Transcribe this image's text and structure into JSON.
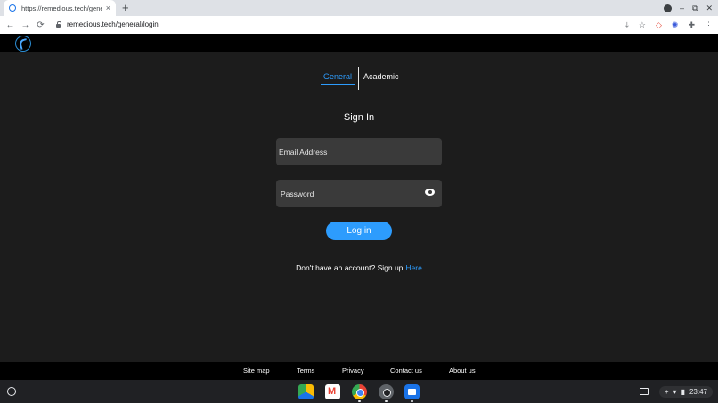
{
  "browser": {
    "tab_title": "https://remedious.tech/general/",
    "tab_close": "×",
    "new_tab": "+",
    "url": "remedious.tech/general/login",
    "nav": {
      "back": "←",
      "forward": "→",
      "reload": "⟳"
    },
    "window_controls": {
      "minimize": "–",
      "restore": "⧉",
      "close": "✕"
    }
  },
  "toolbar_icons": [
    "download-icon",
    "star-icon",
    "extension-red-icon",
    "extension-blue-icon",
    "puzzle-icon",
    "menu-icon"
  ],
  "toolbar_glyphs": {
    "download": "⤓",
    "star": "☆",
    "ext_red": "◇",
    "ext_blue": "✺",
    "puzzle": "✚",
    "menu": "⋮"
  },
  "login": {
    "tabs": {
      "general": "General",
      "academic": "Academic"
    },
    "title": "Sign In",
    "email_placeholder": "Email Address",
    "password_placeholder": "Password",
    "login_button": "Log in",
    "signup_text": "Don't have an account? Sign up",
    "signup_link": "Here"
  },
  "footer": {
    "links": [
      "Site map",
      "Terms",
      "Privacy",
      "Contact us",
      "About us"
    ]
  },
  "shelf": {
    "apps": [
      "google-drive",
      "gmail",
      "chrome",
      "settings",
      "files"
    ],
    "tray_plus": "+",
    "time": "23:47"
  },
  "colors": {
    "accent": "#2d9cfd",
    "background": "#1c1c1c",
    "field": "#3a3a3a"
  }
}
